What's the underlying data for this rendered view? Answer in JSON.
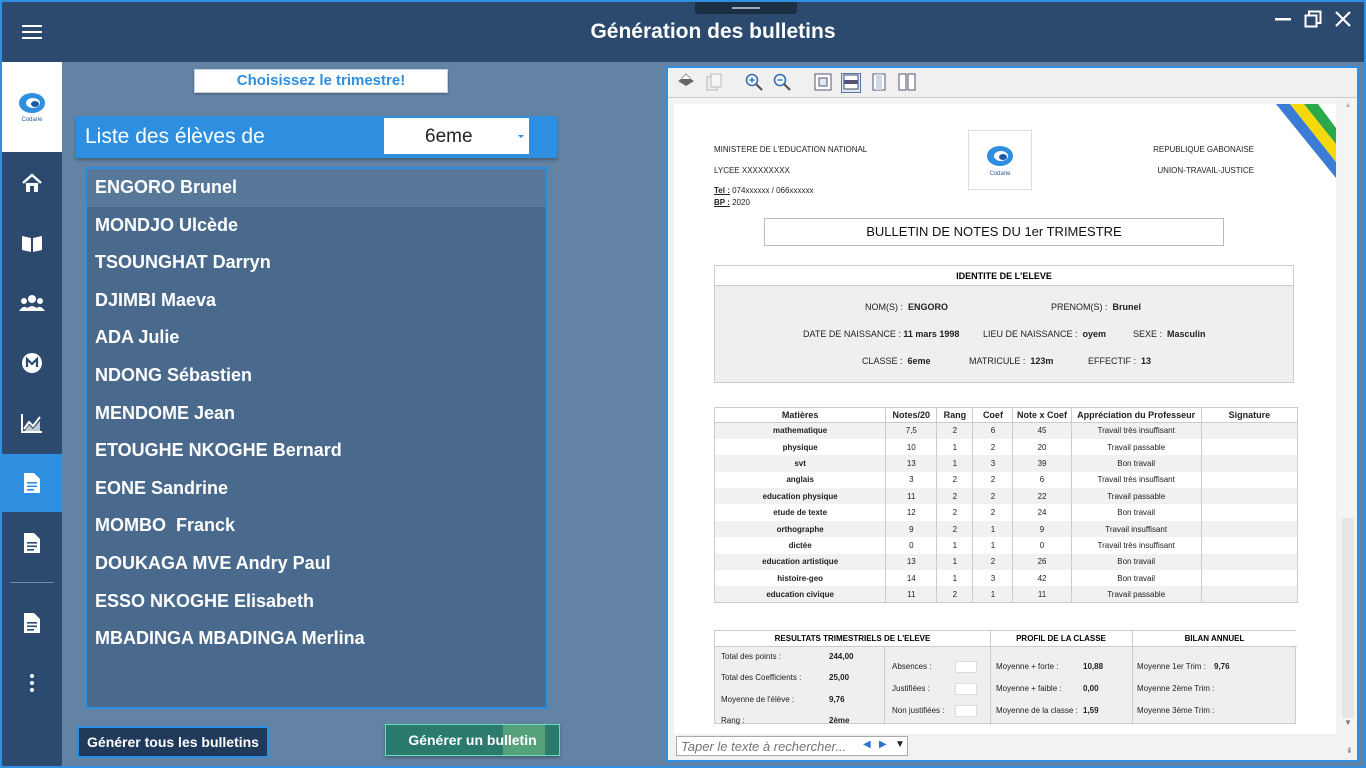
{
  "window": {
    "title": "Génération des bulletins",
    "minimize_icon": "minimize-icon",
    "maximize_icon": "restore-icon",
    "close_icon": "close-icon"
  },
  "sidebar": {
    "logo_text": "Codarie",
    "items": [
      {
        "icon": "hamburger-menu-icon"
      },
      {
        "icon": "home-icon"
      },
      {
        "icon": "book-icon"
      },
      {
        "icon": "users-icon"
      },
      {
        "icon": "metro-icon"
      },
      {
        "icon": "chart-icon"
      },
      {
        "icon": "document-icon",
        "active": true
      },
      {
        "icon": "document-icon"
      },
      {
        "icon": "document-icon"
      },
      {
        "icon": "more-icon"
      }
    ]
  },
  "trimestre_button": "Choisissez le trimestre!",
  "list": {
    "label": "Liste des élèves de",
    "class_value": "6eme",
    "students": [
      "ENGORO Brunel",
      "MONDJO Ulcède",
      "TSOUNGHAT Darryn",
      "DJIMBI Maeva",
      "ADA Julie",
      "NDONG Sébastien",
      "MENDOME Jean",
      "ETOUGHE NKOGHE Bernard",
      "EONE Sandrine",
      "MOMBO  Franck",
      "DOUKAGA MVE Andry Paul",
      "ESSO NKOGHE Elisabeth",
      "MBADINGA MBADINGA Merlina"
    ]
  },
  "buttons": {
    "generate_all": "Générer tous les bulletins",
    "generate_one": "Générer un bulletin"
  },
  "viewer": {
    "search_placeholder": "Taper le texte à rechercher...",
    "page": {
      "ministry": "MINISTERE DE L'EDUCATION NATIONAL",
      "school": "LYCEE XXXXXXXXX",
      "tel_label": "Tel :",
      "tel_value": "074xxxxxx / 066xxxxxx",
      "bp_label": "BP :",
      "bp_value": "2020",
      "logo_text": "Codarie",
      "republic": "REPUBLIQUE GABONAISE",
      "motto": "UNION-TRAVAIL-JUSTICE",
      "title": "BULLETIN DE NOTES DU 1er TRIMESTRE",
      "identity": {
        "header": "IDENTITE DE L'ELEVE",
        "nom_label": "NOM(S) :",
        "nom": "ENGORO",
        "prenom_label": "PRENOM(S) :",
        "prenom": "Brunel",
        "naissance_label": "DATE DE NAISSANCE :",
        "naissance": "11 mars 1998",
        "lieu_label": "LIEU DE NAISSANCE :",
        "lieu": "oyem",
        "sexe_label": "SEXE :",
        "sexe": "Masculin",
        "classe_label": "CLASSE :",
        "classe": "6eme",
        "matricule_label": "MATRICULE :",
        "matricule": "123m",
        "effectif_label": "EFFECTIF :",
        "effectif": "13"
      },
      "grades": {
        "headers": [
          "Matières",
          "Notes/20",
          "Rang",
          "Coef",
          "Note x Coef",
          "Appréciation du Professeur",
          "Signature"
        ],
        "rows": [
          [
            "mathematique",
            "7,5",
            "2",
            "6",
            "45",
            "Travail très insuffisant",
            ""
          ],
          [
            "physique",
            "10",
            "1",
            "2",
            "20",
            "Travail passable",
            ""
          ],
          [
            "svt",
            "13",
            "1",
            "3",
            "39",
            "Bon travail",
            ""
          ],
          [
            "anglais",
            "3",
            "2",
            "2",
            "6",
            "Travail très insuffisant",
            ""
          ],
          [
            "education physique",
            "11",
            "2",
            "2",
            "22",
            "Travail passable",
            ""
          ],
          [
            "etude de texte",
            "12",
            "2",
            "2",
            "24",
            "Bon travail",
            ""
          ],
          [
            "orthographe",
            "9",
            "2",
            "1",
            "9",
            "Travail insuffisant",
            ""
          ],
          [
            "dictée",
            "0",
            "1",
            "1",
            "0",
            "Travail très insuffisant",
            ""
          ],
          [
            "education artistique",
            "13",
            "1",
            "2",
            "26",
            "Bon travail",
            ""
          ],
          [
            "histoire-geo",
            "14",
            "1",
            "3",
            "42",
            "Bon travail",
            ""
          ],
          [
            "education civique",
            "11",
            "2",
            "1",
            "11",
            "Travail passable",
            ""
          ]
        ]
      },
      "results": {
        "h1": "RESULTATS TRIMESTRIELS DE L'ELEVE",
        "h2": "PROFIL DE LA CLASSE",
        "h3": "BILAN ANNUEL",
        "total_points_label": "Total des points :",
        "total_points": "244,00",
        "total_coef_label": "Total des Coefficients :",
        "total_coef": "25,00",
        "moyenne_label": "Moyenne de l'élève :",
        "moyenne": "9,76",
        "rang_label": "Rang :",
        "rang": "2ème",
        "absences_label": "Absences :",
        "justifiees_label": "Justifiées :",
        "non_justifiees_label": "Non justifiées :",
        "moy_forte_label": "Moyenne + forte :",
        "moy_forte": "10,88",
        "moy_faible_label": "Moyenne + faible :",
        "moy_faible": "0,00",
        "moy_classe_label": "Moyenne de la classe :",
        "moy_classe": "1,59",
        "t1_label": "Moyenne 1er Trim :",
        "t1": "9,76",
        "t2_label": "Moyenne 2ème Trim :",
        "t3_label": "Moyenne 3ème Trim :"
      }
    }
  },
  "colors": {
    "accent": "#2e8fe0",
    "sidebar": "#2b4a6d",
    "panel": "#6383a4",
    "list_bg": "#4a6a8d",
    "generate_one": "#2b7a6e"
  }
}
